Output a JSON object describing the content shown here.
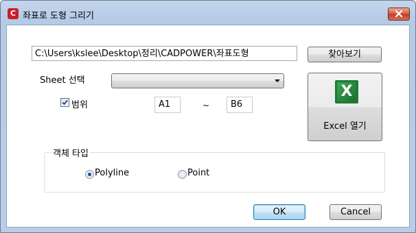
{
  "window": {
    "title": "좌표로 도형 그리기",
    "app_icon_letter": "C",
    "app_icon_color": "#c8202a"
  },
  "file": {
    "path_value": "C:\\Users\\kslee\\Desktop\\정리\\CADPOWER\\좌표도형",
    "browse_label": "찾아보기"
  },
  "sheet": {
    "label": "Sheet 선택",
    "selected": ""
  },
  "excel_button": {
    "icon_letter": "X",
    "label": "Excel 열기",
    "brand_color": "#1e7b34"
  },
  "range": {
    "checkbox_label": "범위",
    "checked": true,
    "from": "A1",
    "separator": "~",
    "to": "B6"
  },
  "object_type": {
    "group_label": "객체 타입",
    "options": [
      {
        "label": "Polyline",
        "selected": true
      },
      {
        "label": "Point",
        "selected": false
      }
    ]
  },
  "footer": {
    "ok_label": "OK",
    "cancel_label": "Cancel"
  }
}
